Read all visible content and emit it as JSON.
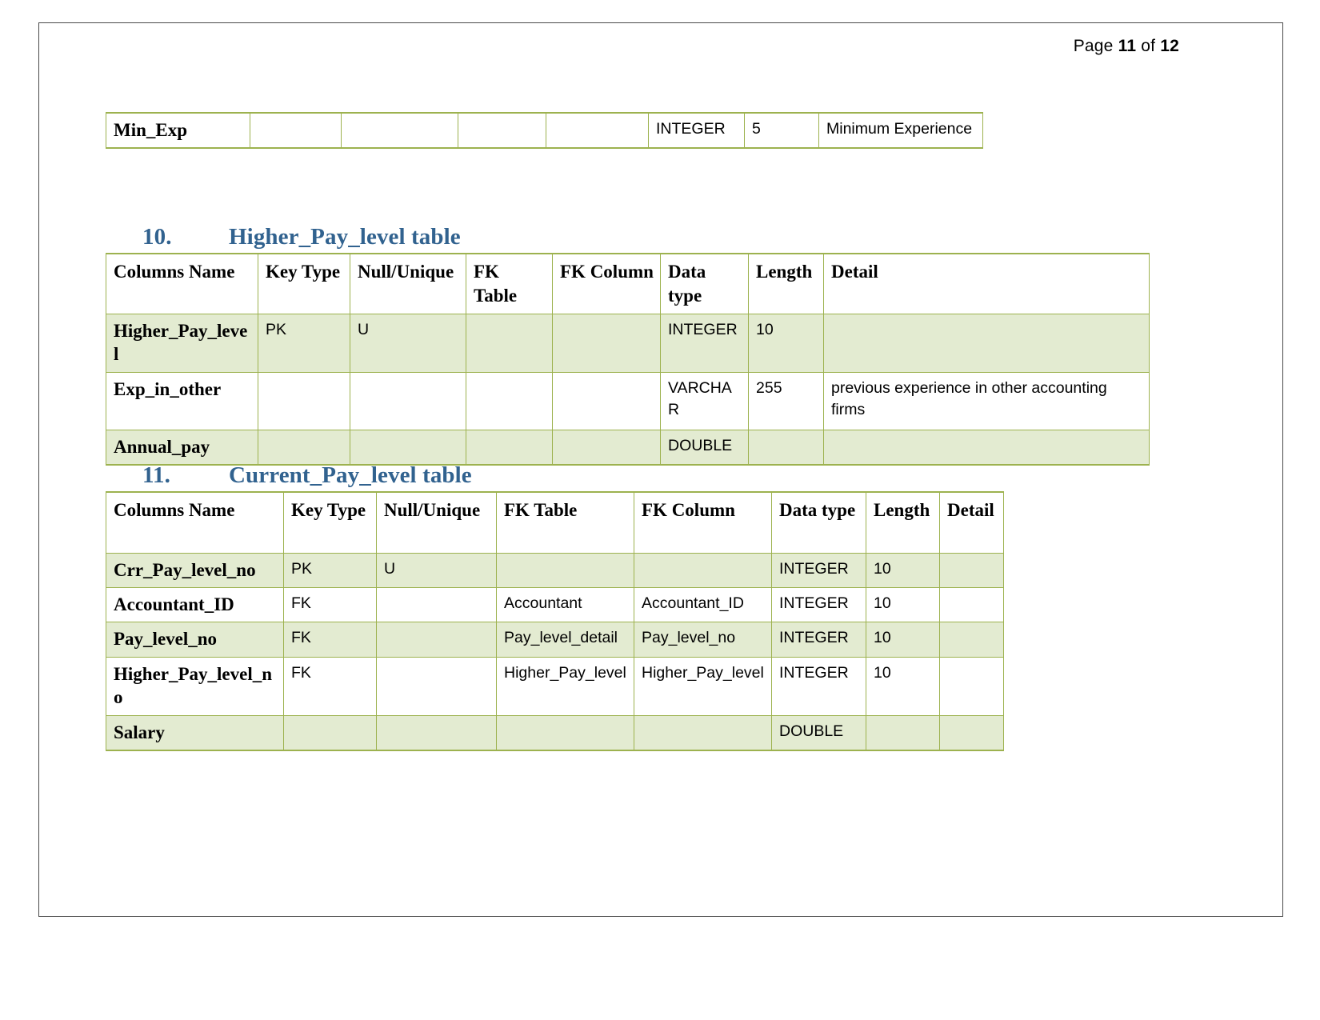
{
  "header": {
    "prefix": "Page",
    "current_page": "11",
    "middle": "of",
    "total_pages": "12"
  },
  "theme": {
    "heading_color": "#31628f",
    "table_border_color": "#9db24f",
    "row_shade_color": "#e3ebd1",
    "page_border_color": "#4a4a4a"
  },
  "top_table_fragment": {
    "row": {
      "column_name": "Min_Exp",
      "key_type": "",
      "null_unique": "",
      "fk_table": "",
      "fk_column": "",
      "data_type": "INTEGER",
      "length": "5",
      "detail": "Minimum Experience"
    }
  },
  "section_10": {
    "number": "10.",
    "title": "Higher_Pay_level table",
    "table": {
      "headers": {
        "columns_name": "Columns Name",
        "key_type": "Key Type",
        "null_unique": "Null/Unique",
        "fk_table": "FK Table",
        "fk_column": "FK Column",
        "data_type": "Data type",
        "length": "Length",
        "detail": "Detail"
      },
      "rows": [
        {
          "column_name": "Higher_Pay_level",
          "key_type": "PK",
          "null_unique": "U",
          "fk_table": "",
          "fk_column": "",
          "data_type": "INTEGER",
          "length": "10",
          "detail": ""
        },
        {
          "column_name": "Exp_in_other",
          "key_type": "",
          "null_unique": "",
          "fk_table": "",
          "fk_column": "",
          "data_type": "VARCHAR",
          "length": "255",
          "detail": "previous experience in other accounting firms"
        },
        {
          "column_name": "Annual_pay",
          "key_type": "",
          "null_unique": "",
          "fk_table": "",
          "fk_column": "",
          "data_type": "DOUBLE",
          "length": "",
          "detail": ""
        }
      ]
    }
  },
  "section_11": {
    "number": "11.",
    "title": "Current_Pay_level table",
    "table": {
      "headers": {
        "columns_name": "Columns Name",
        "key_type": "Key Type",
        "null_unique": "Null/Unique",
        "fk_table": "FK Table",
        "fk_column": "FK Column",
        "data_type": "Data type",
        "length": "Length",
        "detail": "Detail"
      },
      "rows": [
        {
          "column_name": "Crr_Pay_level_no",
          "key_type": "PK",
          "null_unique": "U",
          "fk_table": "",
          "fk_column": "",
          "data_type": "INTEGER",
          "length": "10",
          "detail": ""
        },
        {
          "column_name": "Accountant_ID",
          "key_type": "FK",
          "null_unique": "",
          "fk_table": "Accountant",
          "fk_column": "Accountant_ID",
          "data_type": "INTEGER",
          "length": "10",
          "detail": ""
        },
        {
          "column_name": "Pay_level_no",
          "key_type": "FK",
          "null_unique": "",
          "fk_table": "Pay_level_detail",
          "fk_column": "Pay_level_no",
          "data_type": "INTEGER",
          "length": "10",
          "detail": ""
        },
        {
          "column_name": "Higher_Pay_level_no",
          "key_type": "FK",
          "null_unique": "",
          "fk_table": "Higher_Pay_level",
          "fk_column": "Higher_Pay_level",
          "data_type": "INTEGER",
          "length": "10",
          "detail": ""
        },
        {
          "column_name": "Salary",
          "key_type": "",
          "null_unique": "",
          "fk_table": "",
          "fk_column": "",
          "data_type": "DOUBLE",
          "length": "",
          "detail": ""
        }
      ]
    }
  }
}
